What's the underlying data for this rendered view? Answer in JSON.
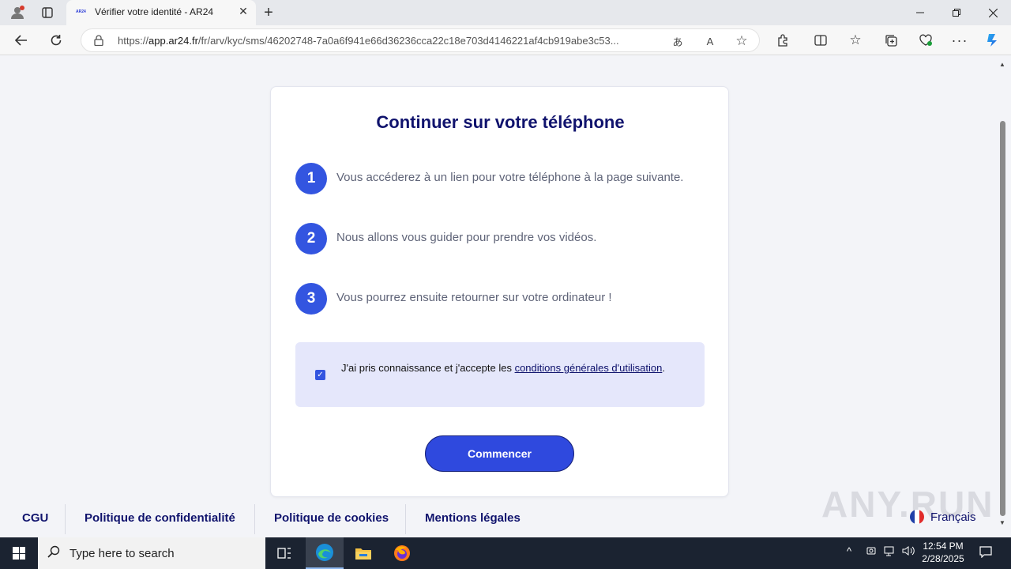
{
  "browser": {
    "tab_title": "Vérifier votre identité - AR24",
    "tab_favicon_text": "AR24",
    "url_prefix": "https://",
    "url_host": "app.ar24.fr",
    "url_path": "/fr/arv/kyc/sms/46202748-7a0a6f941e66d36236cca22c18e703d4146221af4cb919abe3c53...",
    "new_tab_label": "+",
    "close_label": "✕"
  },
  "page": {
    "heading": "Continuer sur votre téléphone",
    "steps": [
      {
        "number": "1",
        "text": "Vous accéderez à un lien pour votre téléphone à la page suivante."
      },
      {
        "number": "2",
        "text": "Nous allons vous guider pour prendre vos vidéos."
      },
      {
        "number": "3",
        "text": "Vous pourrez ensuite retourner sur votre ordinateur !"
      }
    ],
    "consent": {
      "checked": true,
      "text_before": "J'ai pris connaissance et j'accepte les ",
      "link_text": "conditions générales d'utilisation",
      "text_after": "."
    },
    "start_button": "Commencer"
  },
  "footer": {
    "links": [
      "CGU",
      "Politique de confidentialité",
      "Politique de cookies",
      "Mentions légales"
    ],
    "language": "Français"
  },
  "watermark": "ANY.RUN",
  "taskbar": {
    "search_placeholder": "Type here to search",
    "time": "12:54 PM",
    "date": "2/28/2025"
  },
  "colors": {
    "accent": "#3355e0",
    "heading": "#10136d",
    "consent_bg": "#e5e7fb",
    "button_bg": "#2f49de"
  }
}
